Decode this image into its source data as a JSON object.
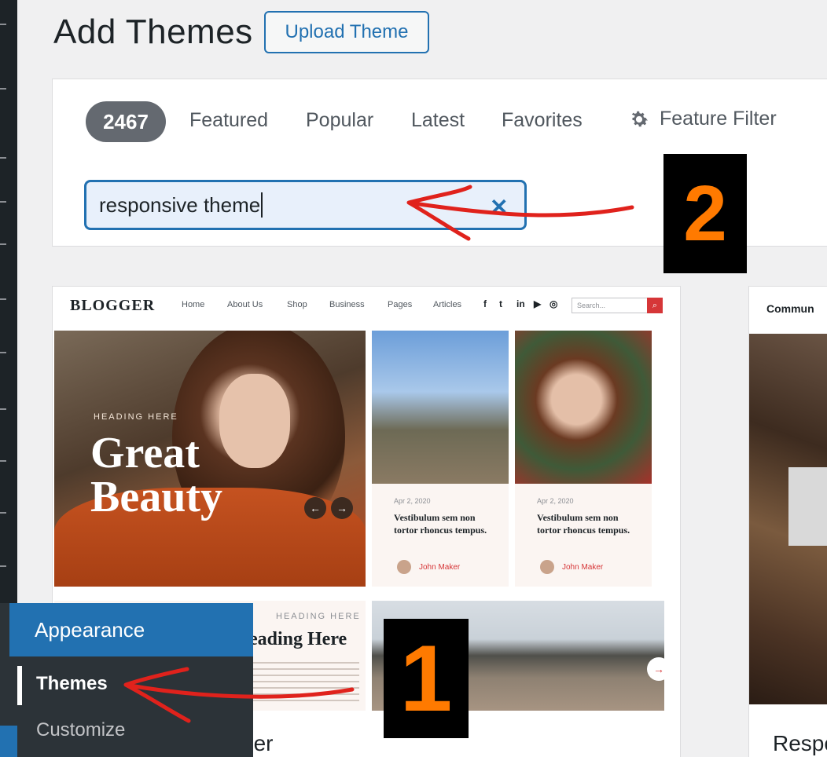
{
  "page": {
    "title": "Add Themes",
    "upload_label": "Upload Theme"
  },
  "filters": {
    "count": "2467",
    "tabs": [
      "Featured",
      "Popular",
      "Latest",
      "Favorites"
    ],
    "feature_filter": "Feature Filter"
  },
  "search": {
    "value": "responsive theme"
  },
  "theme_preview": {
    "logo": "BLOGGER",
    "nav": [
      "Home",
      "About Us",
      "Shop",
      "Business",
      "Pages",
      "Articles"
    ],
    "search_placeholder": "Search...",
    "hero_kicker": "HEADING HERE",
    "hero_title_line1": "Great",
    "hero_title_line2": "Beauty",
    "posts": [
      {
        "date": "Apr 2, 2020",
        "title": "Vestibulum sem non tortor rhoncus tempus.",
        "author": "John Maker"
      },
      {
        "date": "Apr 2, 2020",
        "title": "Vestibulum sem non tortor rhoncus tempus.",
        "author": "John Maker"
      }
    ],
    "lower_kicker": "HEADING HERE",
    "lower_heading": "eading Here",
    "card_name": "ger"
  },
  "theme_preview_2": {
    "header": "Commun",
    "card_name": "Respo"
  },
  "admin_menu": {
    "section": "Appearance",
    "items": [
      "Themes",
      "Customize"
    ]
  },
  "annotations": {
    "step1": "1",
    "step2": "2"
  },
  "colors": {
    "accent": "#2271b1",
    "badge_bg": "#646970",
    "annotation": "#e0221c",
    "step_digit": "#ff7a00"
  }
}
